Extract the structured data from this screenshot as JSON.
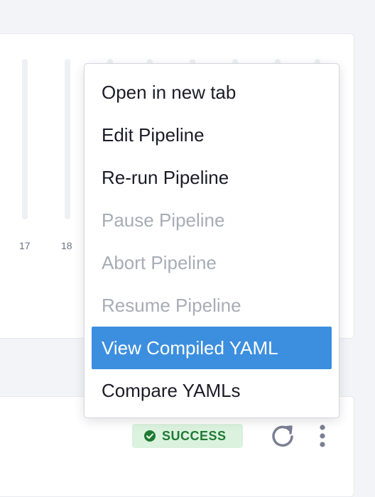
{
  "chart_axis": {
    "ticks": [
      "17",
      "18"
    ]
  },
  "menu": {
    "items": [
      {
        "label": "Open in new tab",
        "state": "enabled"
      },
      {
        "label": "Edit Pipeline",
        "state": "enabled"
      },
      {
        "label": "Re-run Pipeline",
        "state": "enabled"
      },
      {
        "label": "Pause Pipeline",
        "state": "disabled"
      },
      {
        "label": "Abort Pipeline",
        "state": "disabled"
      },
      {
        "label": "Resume Pipeline",
        "state": "disabled"
      },
      {
        "label": "View Compiled YAML",
        "state": "highlighted"
      },
      {
        "label": "Compare YAMLs",
        "state": "enabled"
      }
    ]
  },
  "execution": {
    "status_label": "SUCCESS",
    "status_icon": "check-circle-icon",
    "status_color": "#1f7a33",
    "status_bg": "#dbf2de"
  },
  "colors": {
    "accent": "#3c8fdf",
    "disabled_text": "#a9acb6"
  }
}
